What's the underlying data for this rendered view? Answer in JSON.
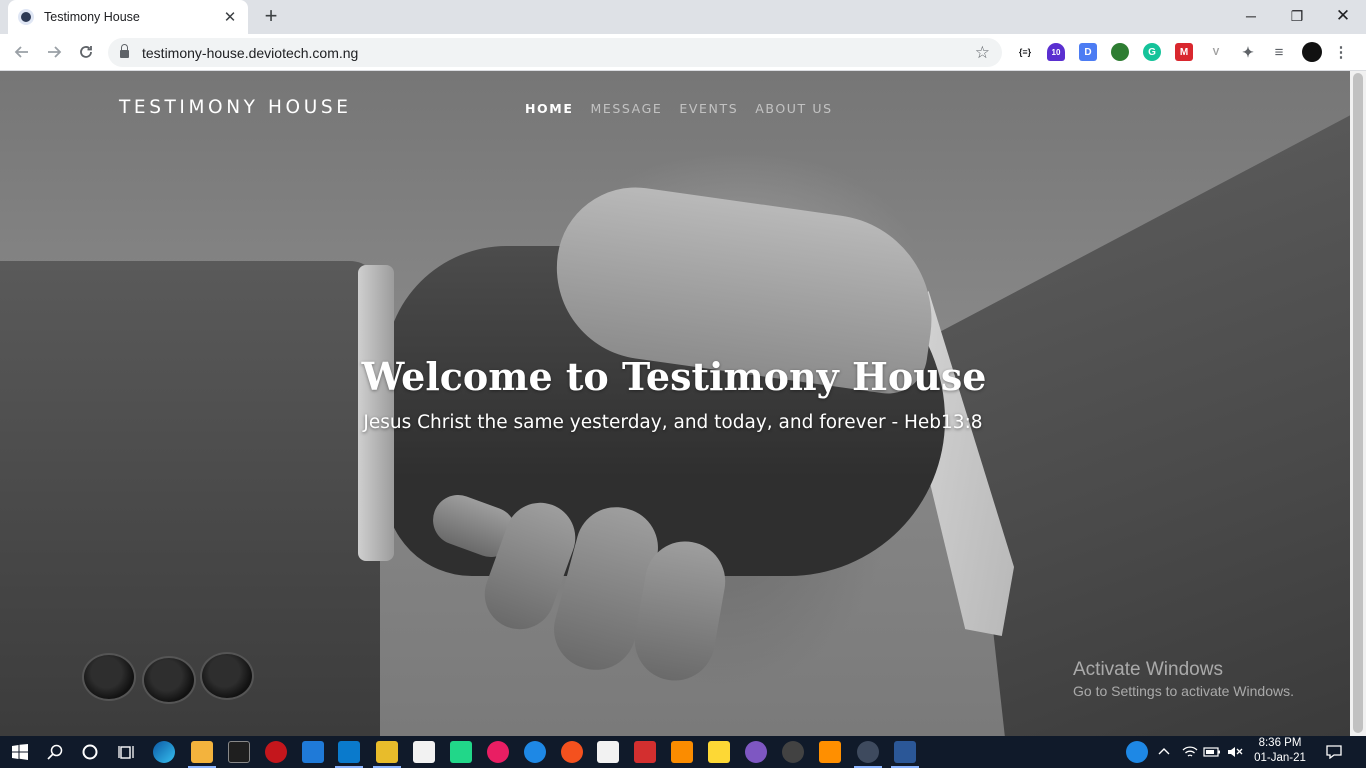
{
  "browser": {
    "tab_title": "Testimony House",
    "tab_close": "✕",
    "new_tab": "+",
    "url": "testimony-house.deviotech.com.ng",
    "window": {
      "minimize": "─",
      "restore": "❐",
      "close": "✕"
    },
    "extensions": [
      {
        "name": "json-formatter",
        "label": "{≡}",
        "color": "#ffffff"
      },
      {
        "name": "classroom-badge",
        "label": "10",
        "color": "#5a2fd0"
      },
      {
        "name": "d-extension",
        "label": "D",
        "color": "#4c7cf3"
      },
      {
        "name": "globe-extension",
        "label": "",
        "color": "#2e7d32"
      },
      {
        "name": "grammarly",
        "label": "G",
        "color": "#15c39a"
      },
      {
        "name": "mega-extension",
        "label": "M",
        "color": "#d9272e"
      },
      {
        "name": "v-extension",
        "label": "V",
        "color": "#9e9e9e"
      },
      {
        "name": "puzzle",
        "label": "✦",
        "color": "#5f6368"
      },
      {
        "name": "media-queue",
        "label": "≡",
        "color": "#5f6368"
      }
    ]
  },
  "site": {
    "logo": "TESTIMONY HOUSE",
    "nav": [
      "HOME",
      "MESSAGE",
      "EVENTS",
      "ABOUT US"
    ],
    "hero_title": "Welcome to Testimony House",
    "hero_subtitle": "Jesus Christ the same yesterday, and today, and forever - Heb13:8"
  },
  "watermark": {
    "line1": "Activate Windows",
    "line2": "Go to Settings to activate Windows."
  },
  "taskbar": {
    "time": "8:36 PM",
    "date": "01-Jan-21"
  }
}
